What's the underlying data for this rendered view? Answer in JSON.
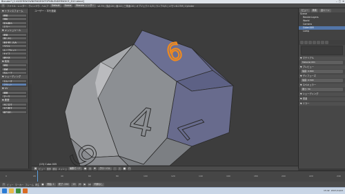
{
  "window": {
    "title": "Blender* [C:¥USERS¥OWNER¥DESKTOP¥BLENDER¥DICE_D10.blend]",
    "controls": [
      "–",
      "□",
      "✕"
    ]
  },
  "info_bar": {
    "menus": [
      "ファイル",
      "レンダー",
      "ウィンドウ",
      "ヘルプ"
    ],
    "layout": "Default",
    "scene": "Scene",
    "engine": "Blender レンダー",
    "version_stats": "v2.79 | 頂点:20 | 面:10 | 三角面:20 | オブジェクト:1/3 | ランプ:0/1 | メモリ:8.27M | Cylinder"
  },
  "toolshelf": {
    "sections": [
      {
        "title": "▼ トランスフォーム",
        "buttons": [
          "移動",
          "回転",
          "拡大縮小",
          "ミラー"
        ]
      },
      {
        "title": "▼ メッシュツール",
        "buttons": [
          "複製",
          "押し出し",
          "面を差し込み",
          "ベベル",
          "ループカット",
          "ナイフ",
          "細分化"
        ]
      },
      {
        "title": "▼ 削除",
        "buttons": [
          "削除",
          "溶解",
          "辺ループ"
        ]
      },
      {
        "title": "▼ シェーディング",
        "buttons": [
          "スムーズ",
          "フラット"
        ]
      },
      {
        "title": "▼ UV",
        "buttons": [
          "展開",
          "マーク"
        ]
      },
      {
        "title": "▼ 履歴",
        "buttons": [
          "元に戻す",
          "やり直す",
          "繰り返し"
        ]
      }
    ],
    "selected_button": "フラット"
  },
  "viewport": {
    "view_label": "ユーザー・平行投影",
    "object_label": "(23) Cube.005",
    "face_numbers": [
      "6",
      "4",
      "9",
      "7"
    ],
    "colors": {
      "background": "#3d3d3d",
      "face_light": "#8a8d91",
      "face_dark": "#55587a",
      "highlight": "#f08a1e",
      "edge": "#2a2a2a"
    }
  },
  "view3d_header": {
    "view_menu": "ビュー",
    "select_menu": "選択",
    "add_menu": "追加",
    "object_menu": "メッシュ",
    "mode": "編集モード",
    "pivot": "グローバル"
  },
  "outliner": {
    "header_buttons": [
      "ビュー",
      "検索",
      "全シーン"
    ],
    "items": [
      "Scene",
      "RenderLayers",
      "World",
      "Camera",
      "Cube.005",
      "Lamp"
    ],
    "selected_item": "Cube.005"
  },
  "properties": {
    "tab_icons": [
      "camera-icon",
      "layers-icon",
      "scene-icon",
      "world-icon",
      "object-icon",
      "material-icon",
      "texture-icon"
    ],
    "sections": [
      "▼ マテリアル",
      "▼ プレビュー",
      "▼ ディフューズ",
      "▼ スペキュラー",
      "▼ シェーディング",
      "▼ 透過",
      "▼ ミラー"
    ],
    "fields": [
      "Material.001",
      "強度: 0.800",
      "強度: 0.500",
      "硬さ: 50"
    ]
  },
  "timeline": {
    "ticks": [
      "0",
      "20",
      "40",
      "60",
      "80",
      "100",
      "120",
      "140",
      "160",
      "180",
      "200",
      "220",
      "240"
    ],
    "header": {
      "view": "ビュー",
      "marker": "マーカー",
      "frame": "フレーム",
      "playback": "再生",
      "start": "開始: 1",
      "end": "終了: 250",
      "current": "23",
      "sync": "同期なし"
    }
  },
  "taskbar": {
    "time": "15:42",
    "date": "2017/11/03"
  }
}
